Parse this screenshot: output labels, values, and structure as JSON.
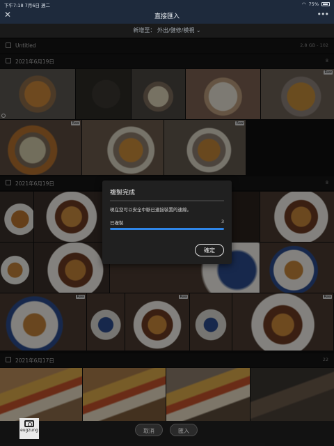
{
  "status_bar": {
    "time": "下午7:18",
    "date": "7月6日 週二",
    "battery": "75%"
  },
  "header": {
    "close_glyph": "✕",
    "title": "直接匯入",
    "more_glyph": "•••"
  },
  "destination": {
    "label": "新增至：",
    "value": "外出/健修/模視",
    "chevron": "⌄"
  },
  "sections": [
    {
      "label": "Untitled",
      "meta": "2.8 GB - 102"
    },
    {
      "label": "2021年6月19日",
      "meta": "8"
    },
    {
      "label": "2021年6月19日",
      "meta": "8"
    },
    {
      "label": "2021年6月17日",
      "meta": "22"
    }
  ],
  "raw_badge": "Raw",
  "dialog": {
    "title": "複製完成",
    "message": "現在您可以安全中斷已連接裝置的連線。",
    "progress_label": "已複製",
    "progress_count": "3",
    "progress_fraction": 1.0,
    "ok_label": "確定"
  },
  "bottom": {
    "cancel_label": "取消",
    "import_label": "匯入"
  },
  "logo_text": "eugzung",
  "colors": {
    "accent": "#2f86e8",
    "header_bg": "#1e2a3c"
  }
}
